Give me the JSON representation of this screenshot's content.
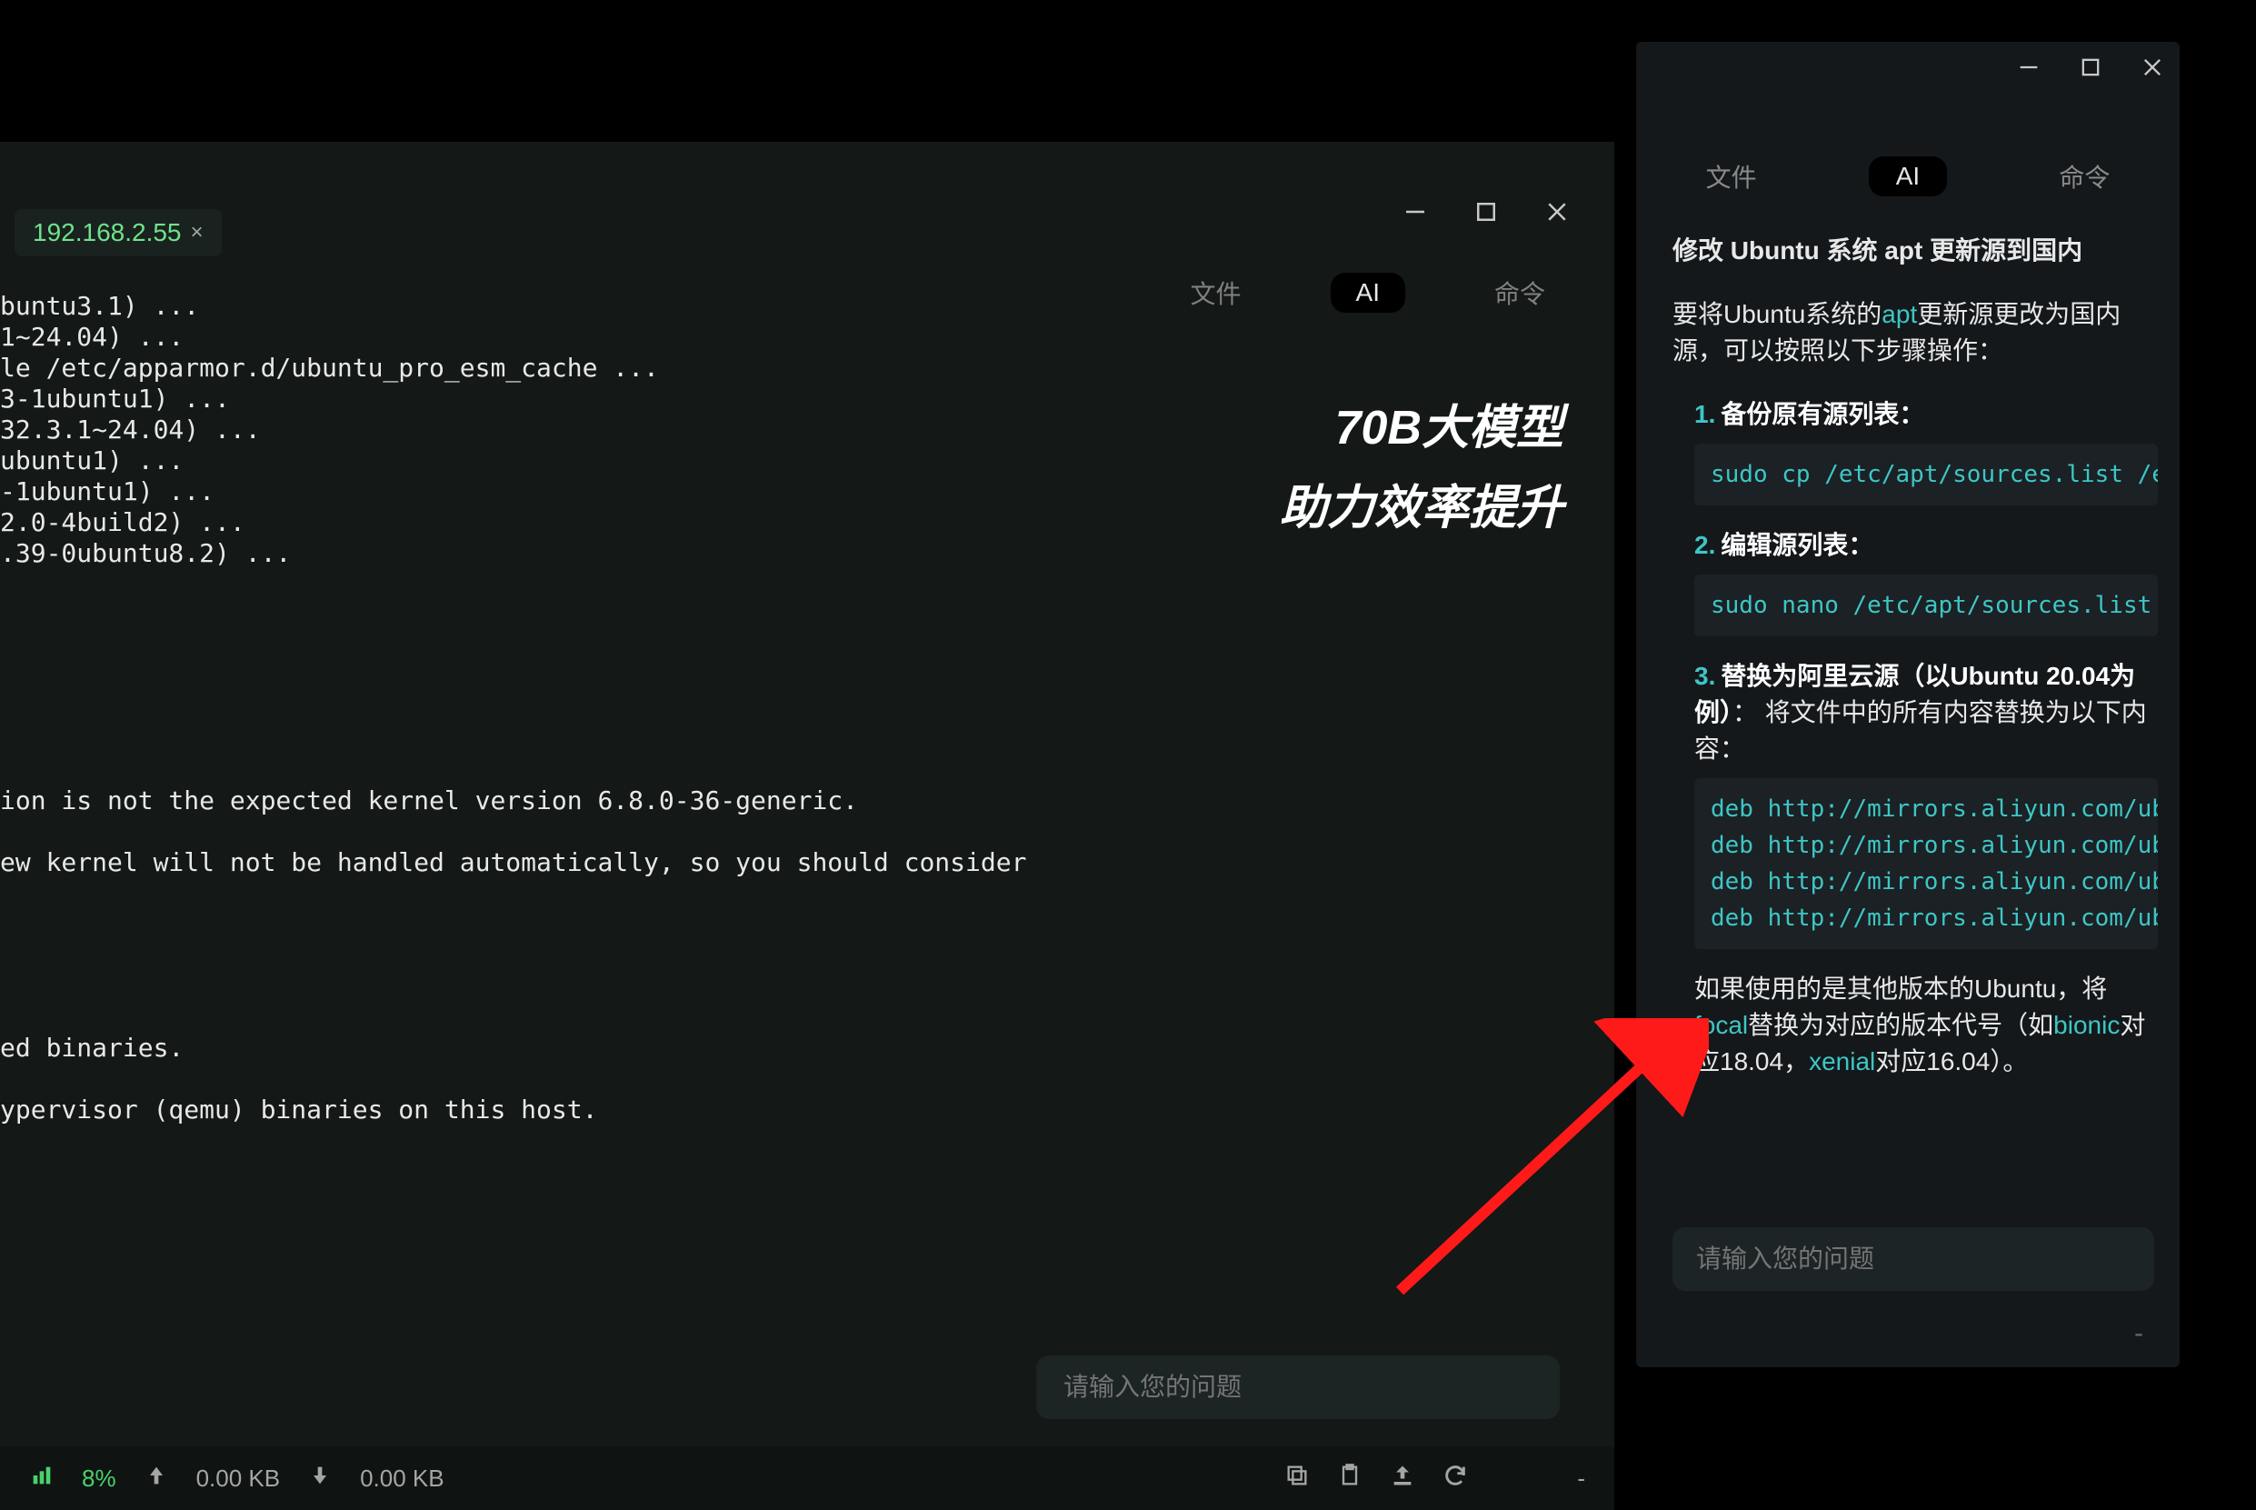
{
  "left": {
    "host_tab": "192.168.2.55",
    "subtabs": {
      "file": "文件",
      "ai": "AI",
      "cmd": "命令"
    },
    "headline1": "70B大模型",
    "headline2": "助力效率提升",
    "term_lines": [
      "buntu3.1) ...",
      "1~24.04) ...",
      "le /etc/apparmor.d/ubuntu_pro_esm_cache ...",
      "3-1ubuntu1) ...",
      "32.3.1~24.04) ...",
      "ubuntu1) ...",
      "-1ubuntu1) ...",
      "2.0-4build2) ...",
      ".39-0ubuntu8.2) ...",
      "",
      "",
      "",
      "",
      "",
      "",
      "",
      "ion is not the expected kernel version 6.8.0-36-generic.",
      "",
      "ew kernel will not be handled automatically, so you should consider",
      "",
      "",
      "",
      "",
      "",
      "ed binaries.",
      "",
      "ypervisor (qemu) binaries on this host."
    ],
    "input_placeholder": "请输入您的问题",
    "status": {
      "cpu": "8%",
      "up": "0.00 KB",
      "down": "0.00 KB"
    }
  },
  "right": {
    "tabs": {
      "file": "文件",
      "ai": "AI",
      "cmd": "命令"
    },
    "title": "修改 Ubuntu 系统 apt 更新源到国内",
    "intro_before": "要将Ubuntu系统的",
    "intro_accent": "apt",
    "intro_after": "更新源更改为国内源，可以按照以下步骤操作：",
    "step1_num": "1.",
    "step1_title": "备份原有源列表：",
    "step1_code": "sudo cp /etc/apt/sources.list /etc/",
    "step2_num": "2.",
    "step2_title": "编辑源列表：",
    "step2_code": "sudo nano /etc/apt/sources.list",
    "step3_num": "3.",
    "step3_title": "替换为阿里云源（以Ubuntu 20.04为例）",
    "step3_body": "： 将文件中的所有内容替换为以下内容：",
    "deb1": "deb http://mirrors.aliyun.com/ubu",
    "deb2": "deb http://mirrors.aliyun.com/ubu",
    "deb3": "deb http://mirrors.aliyun.com/ubu",
    "deb4": "deb http://mirrors.aliyun.com/ubu",
    "note_a": "如果使用的是其他版本的Ubuntu，将",
    "note_focal": "focal",
    "note_b": "替换为对应的版本代号（如",
    "note_bionic": "bionic",
    "note_c": "对应18.04，",
    "note_xenial": "xenial",
    "note_d": "对应16.04）。",
    "input_placeholder": "请输入您的问题",
    "footer_dash": "-"
  }
}
